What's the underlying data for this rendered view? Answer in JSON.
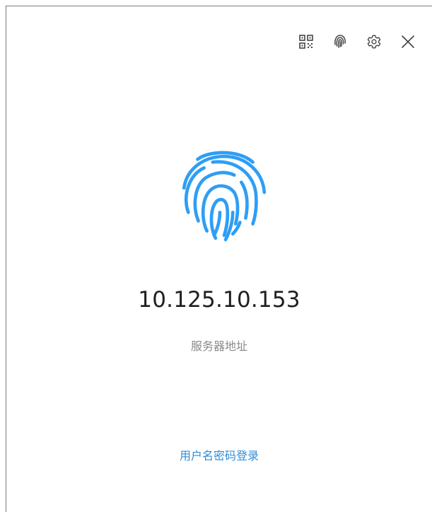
{
  "toolbar": {
    "icons": [
      "qr-code-icon",
      "fingerprint-icon",
      "gear-icon",
      "close-icon"
    ]
  },
  "main": {
    "server_address": "10.125.10.153",
    "server_label": "服务器地址",
    "login_link": "用户名密码登录"
  },
  "colors": {
    "accent": "#2e9ef5",
    "link": "#2f8ed8",
    "icon": "#444444",
    "text": "#1f1f1f",
    "muted": "#8a8a8a"
  }
}
